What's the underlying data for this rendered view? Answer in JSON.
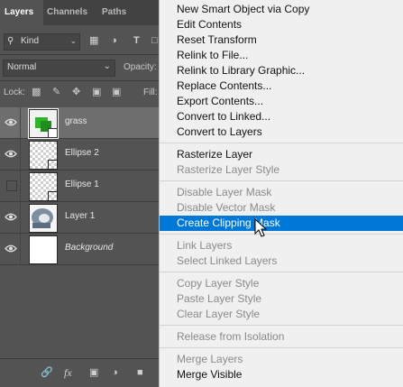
{
  "layers_panel": {
    "tabs": [
      {
        "label": "Layers",
        "active": true
      },
      {
        "label": "Channels",
        "active": false
      },
      {
        "label": "Paths",
        "active": false
      }
    ],
    "filter": {
      "kind_label": "Kind"
    },
    "blend_mode": "Normal",
    "opacity_label": "Opacity:",
    "lock_label": "Lock:",
    "fill_label": "Fill:",
    "layers": [
      {
        "name": "grass",
        "visible": true,
        "selected": true,
        "thumb": "smart-object"
      },
      {
        "name": "Ellipse 2",
        "visible": true,
        "selected": false,
        "thumb": "shape"
      },
      {
        "name": "Ellipse 1",
        "visible": false,
        "selected": false,
        "thumb": "shape"
      },
      {
        "name": "Layer 1",
        "visible": true,
        "selected": false,
        "thumb": "image"
      },
      {
        "name": "Background",
        "visible": true,
        "selected": false,
        "thumb": "white",
        "italic": true
      }
    ]
  },
  "context_menu": {
    "items": [
      {
        "label": "New Smart Object via Copy",
        "disabled": false
      },
      {
        "label": "Edit Contents",
        "disabled": false
      },
      {
        "label": "Reset Transform",
        "disabled": false
      },
      {
        "label": "Relink to File...",
        "disabled": false
      },
      {
        "label": "Relink to Library Graphic...",
        "disabled": false
      },
      {
        "label": "Replace Contents...",
        "disabled": false
      },
      {
        "label": "Export Contents...",
        "disabled": false
      },
      {
        "label": "Convert to Linked...",
        "disabled": false
      },
      {
        "label": "Convert to Layers",
        "disabled": false
      },
      {
        "label": "Rasterize Layer",
        "disabled": false
      },
      {
        "label": "Rasterize Layer Style",
        "disabled": true
      },
      {
        "label": "Disable Layer Mask",
        "disabled": true
      },
      {
        "label": "Disable Vector Mask",
        "disabled": true
      },
      {
        "label": "Create Clipping Mask",
        "disabled": false,
        "highlighted": true
      },
      {
        "label": "Link Layers",
        "disabled": true
      },
      {
        "label": "Select Linked Layers",
        "disabled": true
      },
      {
        "label": "Copy Layer Style",
        "disabled": true
      },
      {
        "label": "Paste Layer Style",
        "disabled": true
      },
      {
        "label": "Clear Layer Style",
        "disabled": true
      },
      {
        "label": "Release from Isolation",
        "disabled": true
      },
      {
        "label": "Merge Layers",
        "disabled": true
      },
      {
        "label": "Merge Visible",
        "disabled": false
      }
    ],
    "highlight_color": "#0078d7"
  }
}
